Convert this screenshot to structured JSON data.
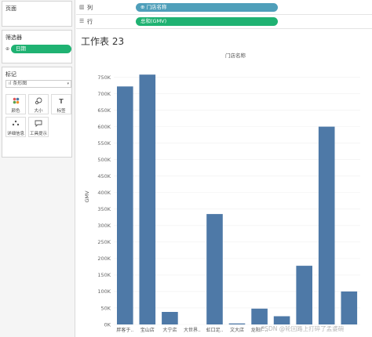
{
  "left_panel": {
    "pages": {
      "title": "页面"
    },
    "filters": {
      "title": "筛选器",
      "pill": "日期"
    },
    "marks": {
      "title": "标记",
      "type": "条形图",
      "buttons": [
        {
          "label": "颜色",
          "icon": "color-icon"
        },
        {
          "label": "大小",
          "icon": "size-icon"
        },
        {
          "label": "标签",
          "icon": "label-icon"
        },
        {
          "label": "详细信息",
          "icon": "detail-icon"
        },
        {
          "label": "工具提示",
          "icon": "tooltip-icon"
        }
      ]
    }
  },
  "shelves": {
    "columns": {
      "label": "列",
      "pill": "门店名称"
    },
    "rows": {
      "label": "行",
      "pill": "总和(GMV)"
    }
  },
  "sheet": {
    "title": "工作表 23"
  },
  "chart_data": {
    "type": "bar",
    "title": "门店名称",
    "xlabel": "",
    "ylabel": "GMV",
    "ylim": [
      0,
      775000
    ],
    "yticks": [
      0,
      50000,
      100000,
      150000,
      200000,
      250000,
      300000,
      350000,
      400000,
      450000,
      500000,
      550000,
      600000,
      650000,
      700000,
      750000
    ],
    "ytick_labels": [
      "0K",
      "50K",
      "100K",
      "150K",
      "200K",
      "250K",
      "300K",
      "350K",
      "400K",
      "450K",
      "500K",
      "550K",
      "600K",
      "650K",
      "700K",
      "750K"
    ],
    "categories": [
      "胖客于..",
      "宝山店",
      "大宁店",
      "大世界..",
      "虹口足..",
      "文大店",
      "龙阳广..",
      "",
      "",
      "",
      ""
    ],
    "values": [
      722000,
      758000,
      38000,
      0,
      335000,
      3000,
      48000,
      25000,
      178000,
      600000,
      100000
    ],
    "bar_color": "#4e79a7",
    "grid": true
  },
  "watermark": "CSDN @轮回路上打碎了孟婆碗"
}
